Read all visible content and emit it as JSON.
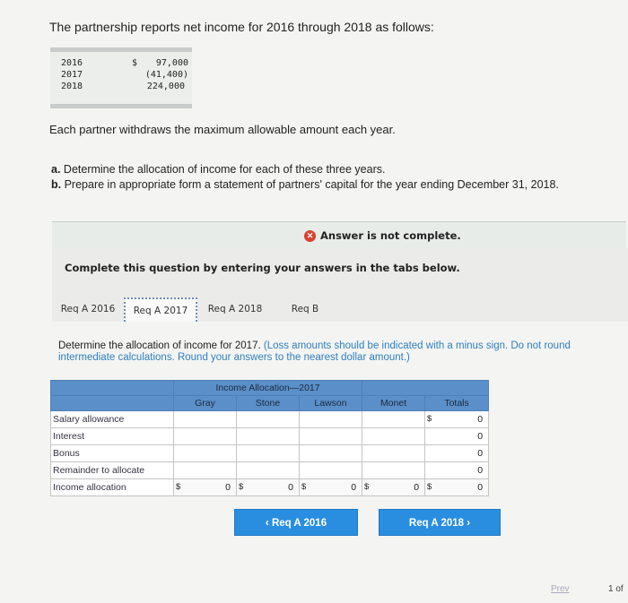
{
  "intro": "The partnership reports net income for 2016 through 2018 as follows:",
  "income": [
    {
      "year": "2016",
      "dollar": "$",
      "amount": "97,000"
    },
    {
      "year": "2017",
      "dollar": "",
      "amount": "(41,400)"
    },
    {
      "year": "2018",
      "dollar": "",
      "amount": "224,000"
    }
  ],
  "withdraw": "Each partner withdraws the maximum allowable amount each year.",
  "tasks": {
    "a_marker": "a.",
    "a_text": "Determine the allocation of income for each of these three years.",
    "b_marker": "b.",
    "b_text": "Prepare in appropriate form a statement of partners' capital for the year ending December 31, 2018."
  },
  "feedback": {
    "icon": "x-icon",
    "text": "Answer is not complete."
  },
  "complete_prompt": "Complete this question by entering your answers in the tabs below.",
  "tabs": [
    {
      "label": "Req A 2016"
    },
    {
      "label": "Req A 2017"
    },
    {
      "label": "Req A 2018"
    },
    {
      "label": "Req B"
    }
  ],
  "question": {
    "main": "Determine the allocation of income for 2017.",
    "hint": "(Loss amounts should be indicated with a minus sign. Do not round intermediate calculations. Round your answers to the nearest dollar amount.)"
  },
  "table": {
    "title": "Income Allocation—2017",
    "columns": [
      "Gray",
      "Stone",
      "Lawson",
      "Monet",
      "Totals"
    ],
    "rows": [
      {
        "label": "Salary allowance",
        "total_dollar": "$",
        "total": "0"
      },
      {
        "label": "Interest",
        "total": "0"
      },
      {
        "label": "Bonus",
        "total": "0"
      },
      {
        "label": "Remainder to allocate",
        "total": "0"
      },
      {
        "label": "Income allocation",
        "gray": "0",
        "stone": "0",
        "lawson": "0",
        "monet": "0",
        "total": "0",
        "dollar": "$"
      }
    ]
  },
  "nav": {
    "prev": "Req A 2016",
    "next": "Req A 2018"
  },
  "footer": {
    "prev": "Prev",
    "page": "1 of"
  }
}
